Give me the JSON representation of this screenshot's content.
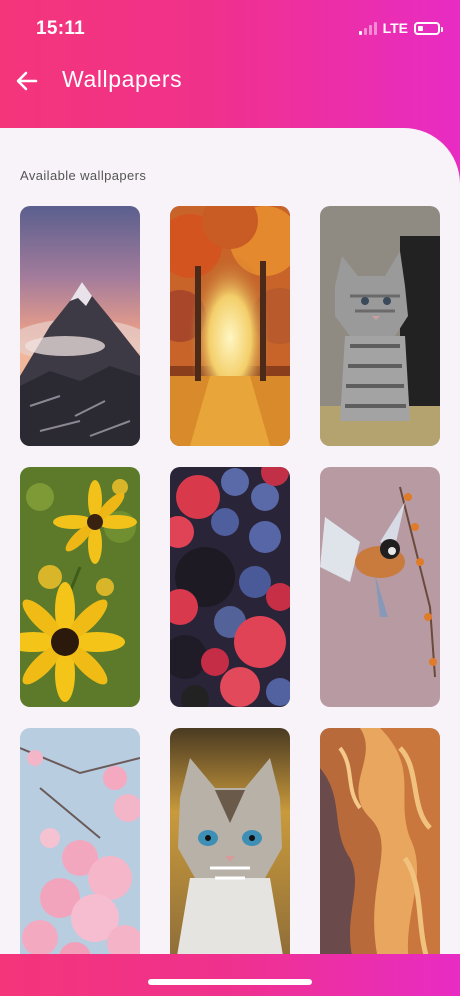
{
  "status_bar": {
    "time": "15:11",
    "network": "LTE",
    "signal_bars": 4,
    "signal_bars_filled": 1,
    "battery_level": 0.2
  },
  "header": {
    "title": "Wallpapers",
    "back_icon": "arrow-left-icon"
  },
  "section": {
    "label": "Available wallpapers"
  },
  "wallpapers": [
    {
      "name": "wallpaper-mountain",
      "subject": "mountain peak at sunset"
    },
    {
      "name": "wallpaper-autumn-forest",
      "subject": "autumn forest path"
    },
    {
      "name": "wallpaper-kitten-gray",
      "subject": "gray tabby kitten"
    },
    {
      "name": "wallpaper-sunflowers",
      "subject": "yellow black-eyed susan flowers"
    },
    {
      "name": "wallpaper-berries",
      "subject": "raspberries, blueberries, blackberries"
    },
    {
      "name": "wallpaper-bird",
      "subject": "small bird in flight"
    },
    {
      "name": "wallpaper-cherry-blossom",
      "subject": "pink cherry blossoms"
    },
    {
      "name": "wallpaper-kitten-blue-eyes",
      "subject": "kitten with blue eyes"
    },
    {
      "name": "wallpaper-canyon",
      "subject": "sandstone canyon"
    }
  ],
  "colors": {
    "brand_pink": "#f4357a",
    "brand_magenta": "#e82cc4",
    "sheet_background": "#f7f3f8"
  }
}
